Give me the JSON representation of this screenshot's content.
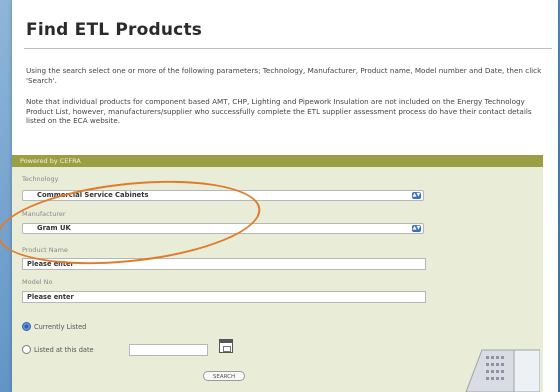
{
  "page": {
    "title": "Find ETL Products",
    "intro": "Using the search select one or more of the following parameters; Technology, Manufacturer, Product name, Model number and Date, then click 'Search'.",
    "note": "Note that individual products for component based AMT, CHP, Lighting and Pipework Insulation are not included on the Energy Technology Product List, however, manufacturers/supplier who successfully complete the ETL supplier assessment process do have their contact details listed on the ECA website."
  },
  "form": {
    "header": "Powered by CEFRA",
    "technology": {
      "label": "Technology",
      "value": "Commercial Service Cabinets"
    },
    "manufacturer": {
      "label": "Manufacturer",
      "value": "Gram UK"
    },
    "product_name": {
      "label": "Product Name",
      "placeholder": "Please enter"
    },
    "model_no": {
      "label": "Model No",
      "placeholder": "Please enter"
    },
    "radio_current": {
      "label": "Currently Listed",
      "selected": true
    },
    "radio_date": {
      "label": "Listed at this date",
      "selected": false
    },
    "search_label": "SEARCH"
  },
  "colors": {
    "header_bar": "#9b9f44",
    "form_bg": "#e9ecd6",
    "highlight_oval": "#e07b2c",
    "page_bg": "#5e92c4"
  }
}
